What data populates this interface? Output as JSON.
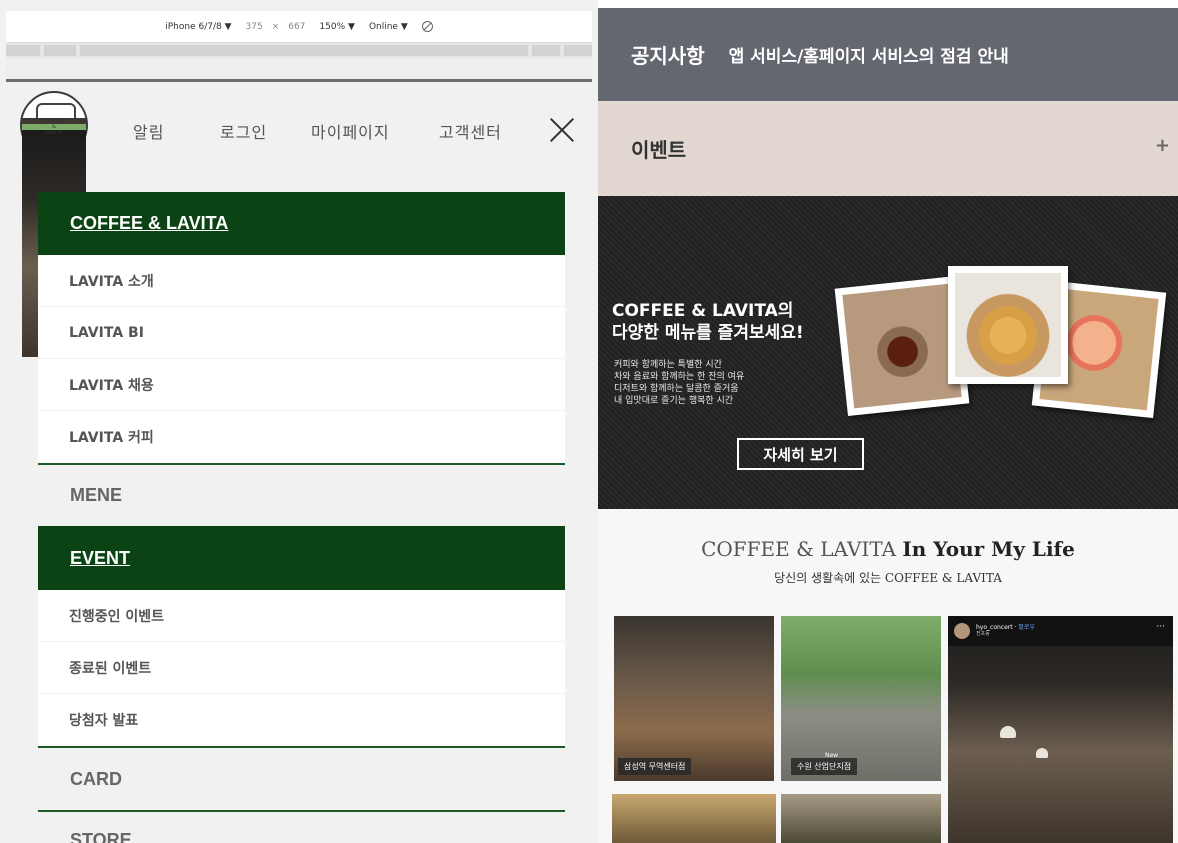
{
  "devtools": {
    "device": "iPhone 6/7/8 ▼",
    "width": "375",
    "times": "×",
    "height": "667",
    "zoom": "150% ▼",
    "network": "Online ▼"
  },
  "mobile": {
    "logo": {
      "line1": "COFFEE",
      "line2": "&",
      "line3": "LAVITA"
    },
    "nav": [
      "알림",
      "로그인",
      "마이페이지",
      "고객센터"
    ],
    "menu": {
      "coffee_head": "COFFEE & LAVITA",
      "coffee_items": [
        "LAVITA 소개",
        "LAVITA BI",
        "LAVITA 채용",
        "LAVITA 커피"
      ],
      "mene": "MENE",
      "event_head": "EVENT",
      "event_items": [
        "진행중인 이벤트",
        "종료된 이벤트",
        "당첨자 발표"
      ],
      "card": "CARD",
      "store": "STORE"
    }
  },
  "page": {
    "notice": {
      "label": "공지사항",
      "text": "앱 서비스/홈페이지 서비스의 점검 안내"
    },
    "event": {
      "label": "이벤트",
      "toggle": "+"
    },
    "banner": {
      "title_line1": "COFFEE & LAVITA의",
      "title_line2": "다양한 메뉴를 즐겨보세요!",
      "lines": [
        "커피와 함께하는 특별한 시간",
        "차와 음료와 함께하는 한 잔의 여유",
        "디저트와 함께하는 달콤한 즐거움",
        "내 입맛대로 즐기는 행복한 시간"
      ],
      "button": "자세히 보기"
    },
    "life": {
      "title_a": "COFFEE & LAVITA",
      "title_b": "In Your My Life",
      "subtitle": "당신의 생활속에 있는 COFFEE & LAVITA"
    },
    "gallery": {
      "tile1_tag": "삼성역 무역센터점",
      "tile2_new": "New",
      "tile2_tag": "수원 산업단지점",
      "insta_user": "hyo_concert",
      "insta_dot": " · ",
      "insta_follow": "팔로우",
      "insta_loc": "전포동",
      "insta_more": "···"
    }
  }
}
